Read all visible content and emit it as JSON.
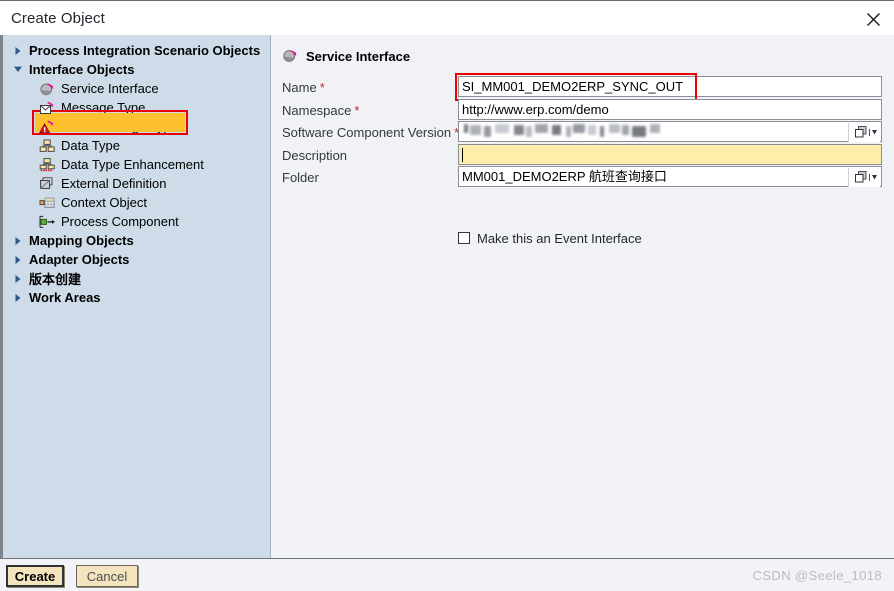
{
  "window": {
    "title": "Create Object",
    "close_icon": "close-icon"
  },
  "tree": {
    "nodes": [
      {
        "label": "Process Integration Scenario Objects",
        "level": 0,
        "twisty": "chevron-right-icon",
        "icon": null,
        "selected": false
      },
      {
        "label": "Interface Objects",
        "level": 0,
        "twisty": "chevron-down-icon",
        "icon": null,
        "selected": false
      },
      {
        "label": "Service Interface",
        "level": 1,
        "twisty": null,
        "icon": "service-interface-icon",
        "selected": true
      },
      {
        "label": "Message Type",
        "level": 1,
        "twisty": null,
        "icon": "message-type-icon",
        "selected": false
      },
      {
        "label": "Fault Message Type",
        "level": 1,
        "twisty": null,
        "icon": "fault-message-type-icon",
        "selected": false
      },
      {
        "label": "Data Type",
        "level": 1,
        "twisty": null,
        "icon": "data-type-icon",
        "selected": false
      },
      {
        "label": "Data Type Enhancement",
        "level": 1,
        "twisty": null,
        "icon": "data-type-enhancement-icon",
        "selected": false
      },
      {
        "label": "External Definition",
        "level": 1,
        "twisty": null,
        "icon": "external-definition-icon",
        "selected": false
      },
      {
        "label": "Context Object",
        "level": 1,
        "twisty": null,
        "icon": "context-object-icon",
        "selected": false
      },
      {
        "label": "Process Component",
        "level": 1,
        "twisty": null,
        "icon": "process-component-icon",
        "selected": false
      },
      {
        "label": "Mapping Objects",
        "level": 0,
        "twisty": "chevron-right-icon",
        "icon": null,
        "selected": false
      },
      {
        "label": "Adapter Objects",
        "level": 0,
        "twisty": "chevron-right-icon",
        "icon": null,
        "selected": false
      },
      {
        "label": "版本创建",
        "level": 0,
        "twisty": "chevron-right-icon",
        "icon": null,
        "selected": false
      },
      {
        "label": "Work Areas",
        "level": 0,
        "twisty": "chevron-right-icon",
        "icon": null,
        "selected": false
      }
    ]
  },
  "form": {
    "header_label": "Service Interface",
    "header_icon": "service-interface-icon",
    "fields": [
      {
        "label": "Name",
        "required": true,
        "value": "SI_MM001_DEMO2ERP_SYNC_OUT",
        "highlight": true,
        "yellow": false,
        "value_help": false,
        "censored": false
      },
      {
        "label": "Namespace",
        "required": true,
        "value": "http://www.erp.com/demo",
        "highlight": false,
        "yellow": false,
        "value_help": false,
        "censored": false
      },
      {
        "label": "Software Component Version",
        "required": true,
        "value": "",
        "highlight": false,
        "yellow": false,
        "value_help": true,
        "censored": true
      },
      {
        "label": "Description",
        "required": false,
        "value": "",
        "highlight": false,
        "yellow": true,
        "value_help": false,
        "censored": false
      },
      {
        "label": "Folder",
        "required": false,
        "value": "MM001_DEMO2ERP 航班查询接口",
        "highlight": false,
        "yellow": false,
        "value_help": true,
        "censored": false
      }
    ],
    "checkbox": {
      "label": "Make this an Event Interface",
      "checked": false
    }
  },
  "footer": {
    "create_label": "Create",
    "cancel_label": "Cancel",
    "watermark": "CSDN @Seele_1018"
  },
  "colors": {
    "tree_background": "#cedce9",
    "form_background": "#f1f2f6",
    "selection": "#fdc02f",
    "highlight_outline": "#ee0000",
    "required_marker": "#c1272d",
    "mandatory_field": "#ffeeaa",
    "footer_button": "#f3e4bd"
  }
}
